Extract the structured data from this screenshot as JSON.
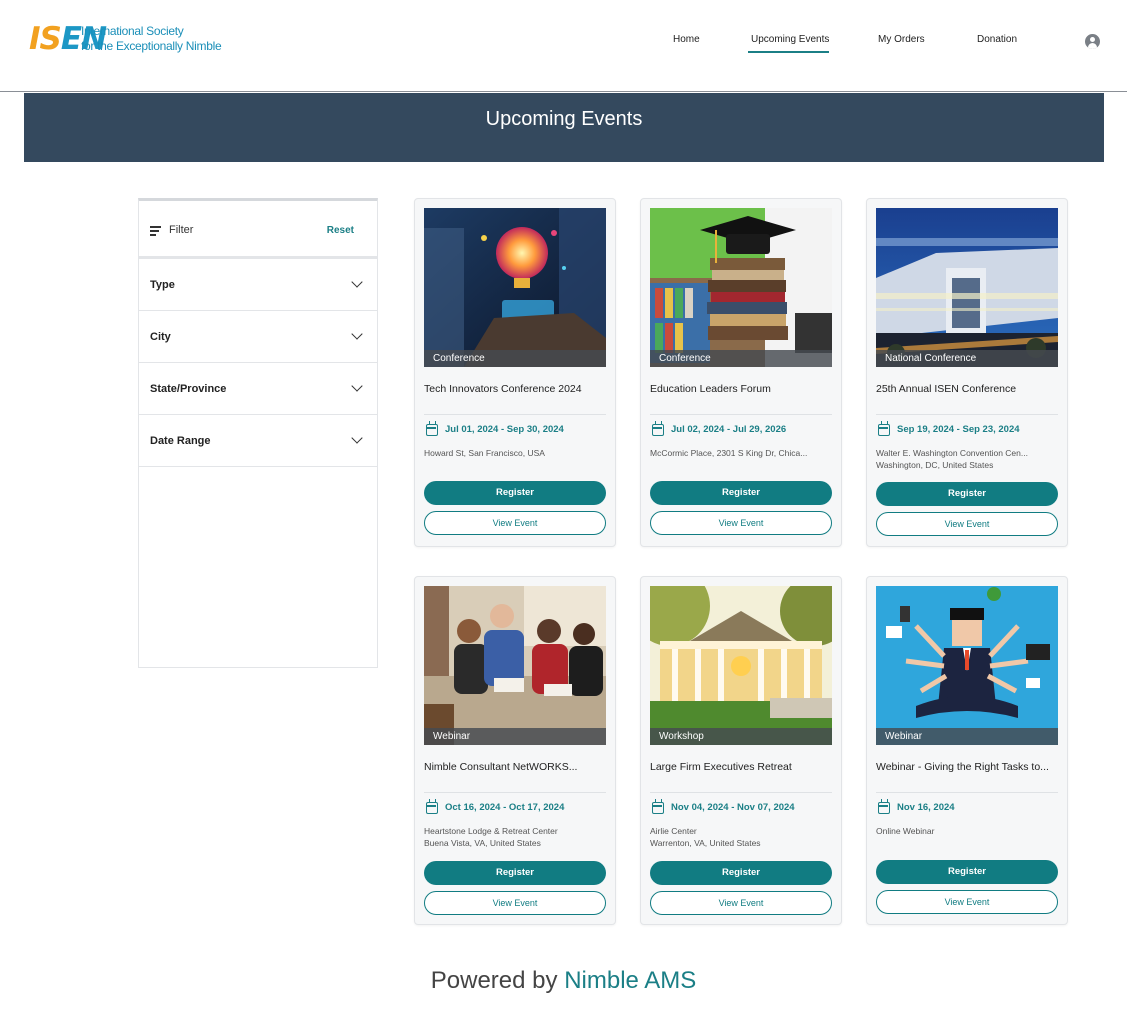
{
  "header": {
    "logo_mark": "ISEN",
    "logo_line1": "International Society",
    "logo_line2": "for the Exceptionally Nimble",
    "nav": [
      {
        "label": "Home"
      },
      {
        "label": "Upcoming Events"
      },
      {
        "label": "My Orders"
      },
      {
        "label": "Donation"
      }
    ],
    "active_nav": "Upcoming Events",
    "user_icon": "user-circle-icon"
  },
  "banner": {
    "title": "Upcoming Events"
  },
  "filter": {
    "label": "Filter",
    "reset_label": "Reset",
    "facets": [
      {
        "label": "Type"
      },
      {
        "label": "City"
      },
      {
        "label": "State/Province"
      },
      {
        "label": "Date Range"
      }
    ]
  },
  "events": [
    {
      "type": "Conference",
      "title": "Tech Innovators Conference 2024",
      "date": "Jul 01, 2024 - Sep 30, 2024",
      "loc1": "Howard St, San Francisco, USA",
      "loc2": "",
      "register_label": "Register",
      "view_label": "View Event"
    },
    {
      "type": "Conference",
      "title": "Education Leaders Forum",
      "date": "Jul 02, 2024 - Jul 29, 2026",
      "loc1": "McCormic Place, 2301 S King Dr, Chica...",
      "loc2": "",
      "register_label": "Register",
      "view_label": "View Event"
    },
    {
      "type": "National Conference",
      "title": "25th Annual ISEN Conference",
      "date": "Sep 19, 2024 - Sep 23, 2024",
      "loc1": "Walter E. Washington Convention Cen...",
      "loc2": "Washington, DC, United States",
      "register_label": "Register",
      "view_label": "View Event"
    },
    {
      "type": "Webinar",
      "title": "Nimble Consultant NetWORKS...",
      "date": "Oct 16, 2024 - Oct 17, 2024",
      "loc1": "Heartstone Lodge & Retreat Center",
      "loc2": "Buena Vista, VA, United States",
      "register_label": "Register",
      "view_label": "View Event"
    },
    {
      "type": "Workshop",
      "title": "Large Firm Executives Retreat",
      "date": "Nov 04, 2024 - Nov 07, 2024",
      "loc1": "Airlie Center",
      "loc2": "Warrenton, VA, United States",
      "register_label": "Register",
      "view_label": "View Event"
    },
    {
      "type": "Webinar",
      "title": "Webinar - Giving the Right Tasks to...",
      "date": "Nov 16, 2024",
      "loc1": "Online Webinar",
      "loc2": "",
      "register_label": "Register",
      "view_label": "View Event"
    }
  ],
  "footer": {
    "prefix": "Powered by",
    "brand": "Nimble AMS"
  },
  "colors": {
    "banner": "#34495e",
    "accent": "#117c82",
    "nav_underline": "#1b7f86"
  }
}
